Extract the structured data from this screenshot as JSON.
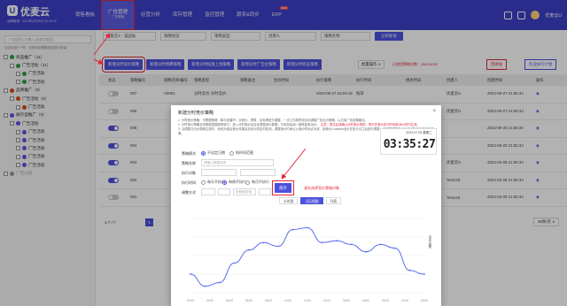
{
  "header": {
    "logo_mark": "U",
    "app_name": "优麦云",
    "logo_sub": "品牌管理 · 2021年6月28日 09:00:00",
    "nav": [
      {
        "label": "销售看板",
        "sub": "",
        "active": false,
        "badge": ""
      },
      {
        "label": "广告管理",
        "sub": "广告策略",
        "active": true,
        "badge": ""
      },
      {
        "label": "经营分析",
        "sub": "",
        "active": false,
        "badge": ""
      },
      {
        "label": "库存管理",
        "sub": "",
        "active": false,
        "badge": ""
      },
      {
        "label": "监控管理",
        "sub": "",
        "active": false,
        "badge": ""
      },
      {
        "label": "跟卖&同步",
        "sub": "",
        "active": false,
        "badge": ""
      },
      {
        "label": "ERP",
        "sub": "",
        "active": false,
        "badge": "NEW"
      }
    ],
    "user_name": "优麦云U"
  },
  "left_panel": {
    "search_placeholder": "广告组合 (与输入关键字搜索)",
    "hint": "勾选全选/\"+\"号，可按勾选需要类型进行批量",
    "tree": [
      {
        "label": "商品推广（11）",
        "level": 1,
        "color": "#2f9e44"
      },
      {
        "label": "广告活动（11）",
        "level": 2,
        "color": "#2f9e44"
      },
      {
        "label": "广告活动",
        "level": 3,
        "color": "#2f9e44"
      },
      {
        "label": "广告活动",
        "level": 3,
        "color": "#2f9e44"
      },
      {
        "label": "品牌推广（8）",
        "level": 1,
        "color": "#d9480f"
      },
      {
        "label": "广告活动（8）",
        "level": 2,
        "color": "#d9480f"
      },
      {
        "label": "广告活动",
        "level": 3,
        "color": "#d9480f"
      },
      {
        "label": "展示型推广（5）",
        "level": 1,
        "color": "#7048e8"
      },
      {
        "label": "广告活动",
        "level": 2,
        "color": "#7048e8"
      },
      {
        "label": "广告活动",
        "level": 3,
        "color": "#7048e8"
      },
      {
        "label": "广告活动",
        "level": 3,
        "color": "#7048e8"
      },
      {
        "label": "广告活动",
        "level": 3,
        "color": "#7048e8"
      },
      {
        "label": "广告活动",
        "level": 3,
        "color": "#7048e8"
      },
      {
        "label": "广告活动",
        "level": 3,
        "color": "#7048e8"
      },
      {
        "label": "广告分组",
        "level": 1,
        "color": "#999999"
      }
    ]
  },
  "filters": {
    "store": "优麦云X - 美国站",
    "status": "策略状态",
    "type": "策略类型",
    "creator": "创建人",
    "keyword": "策略名称",
    "query": "立即查询"
  },
  "actions": {
    "buttons": [
      {
        "label": "新增分时竞价策略",
        "highlight": true
      },
      {
        "label": "新增分时预算策略",
        "highlight": false
      },
      {
        "label": "新增分时投放上线策略",
        "highlight": false
      },
      {
        "label": "新增分时广告位策略",
        "highlight": false
      },
      {
        "label": "新增分时状态策略",
        "highlight": false
      }
    ],
    "bulk": "批量操作 ∨",
    "quota": "已使用策略次数：150/15000",
    "recycle": "回收站",
    "log": "作业执行计划"
  },
  "table": {
    "headers": [
      "",
      "状态",
      "策略编号",
      "策略名称/编号",
      "策略类型",
      "策略备注",
      "生效时间",
      "执行策略",
      "执行时间",
      "修改时间",
      "创建人",
      "创建时间",
      "操作"
    ],
    "rows": [
      {
        "on": false,
        "no": "007",
        "code": "V0001",
        "name": "分时竞价 分时竞价",
        "type": "",
        "note": "",
        "date": "2022-06-27 15:04:16",
        "exec": "按日",
        "create": "2022-06-27 21:55:34",
        "owner": "优麦云U"
      },
      {
        "on": false,
        "no": "006",
        "code": "",
        "name": "",
        "type": "",
        "note": "",
        "date": "",
        "exec": "",
        "create": "2022-06-27 21:55:34",
        "owner": "优麦云U"
      },
      {
        "on": true,
        "no": "005",
        "code": "",
        "name": "",
        "type": "",
        "note": "",
        "date": "",
        "exec": "",
        "create": "2022-05-20 21:55:34",
        "owner": ""
      },
      {
        "on": true,
        "no": "004",
        "code": "",
        "name": "",
        "type": "",
        "note": "",
        "date": "",
        "exec": "",
        "create": "2022-05-20 21:55:34",
        "owner": ""
      },
      {
        "on": true,
        "no": "003",
        "code": "",
        "name": "",
        "type": "",
        "note": "",
        "date": "",
        "exec": "",
        "create": "2022-03-28 21:55:34",
        "owner": "优麦云U"
      },
      {
        "on": true,
        "no": "002",
        "code": "",
        "name": "",
        "type": "",
        "note": "",
        "date": "",
        "exec": "",
        "create": "2022-03-28 21:55:34",
        "owner": "Test123"
      },
      {
        "on": false,
        "no": "001",
        "code": "",
        "name": "",
        "type": "",
        "note": "",
        "date": "",
        "exec": "",
        "create": "2022-03-28 21:55:34",
        "owner": "Test123"
      }
    ]
  },
  "pager": {
    "total": "1-7 / 7",
    "current": "1",
    "size": "30条/页 ∨"
  },
  "modal": {
    "title": "新建分时竞价策略",
    "close": "×",
    "desc_1": "1. 分时竞价策略：可根据策略（单次或循环）对竞价、预算、目标等进行调整，一天之内按时段自动调整广告出价策略，以达到广告效果最佳。",
    "desc_2": "2. 分时竞价策略支持根据调整频率进行，进入分时竞价后自动调整竞价数据；可添加后续一键恢复原出价。",
    "desc_red": "注意：提交后请确认分时竞价规则，预计在竞价执行时间前48小时内生效。",
    "desc_3": "3. 当调整日出价周期生效时，系统为保证竞价效果会自动为您定时检测，调整竞价时间点以竞价时间点为准，用竞价Lowbase出价在执行日之后进行调整，请注意调整竞价后续可能会影响广告效果。",
    "labels": {
      "mode": "策略模式",
      "name": "策略名称",
      "object": "执行对象",
      "time": "执行时间",
      "adjust": "调整方式"
    },
    "mode_options": [
      "不设定日期",
      "按时间范围"
    ],
    "name_placeholder": "请输入策略名称",
    "time_options": [
      "每天不执行",
      "每周不执行",
      "每月不执行"
    ],
    "adjust_option": "按照固定值",
    "save": "保存",
    "hint_right": "请先选择竞价策略对象",
    "clock_date": "2022.07.05 星期二",
    "clock_time": "03:35:27",
    "view_tabs": [
      {
        "label": "分时图",
        "active": false
      },
      {
        "label": "日历视图",
        "active": true
      },
      {
        "label": "列表",
        "active": false
      }
    ],
    "legend": "出价走势",
    "x_labels": [
      "00:00",
      "02:00",
      "04:00",
      "06:00",
      "08:00",
      "10:00",
      "12:00",
      "14:00",
      "16:00",
      "18:00",
      "20:00",
      "22:00",
      "24:00"
    ]
  },
  "chart_data": {
    "type": "line",
    "series": [
      {
        "name": "",
        "values": [
          1.0,
          0.35,
          0.55,
          1.6,
          2.3,
          2.7,
          2.5,
          3.4,
          3.5,
          2.7,
          2.8,
          2.6,
          2.2,
          2.6,
          2.4,
          1.2,
          1.0
        ]
      }
    ],
    "ylim": [
      0,
      4
    ]
  },
  "colors": {
    "brand": "#3d3fc8",
    "accent": "#4c51dc",
    "callout": "#e0283a"
  }
}
